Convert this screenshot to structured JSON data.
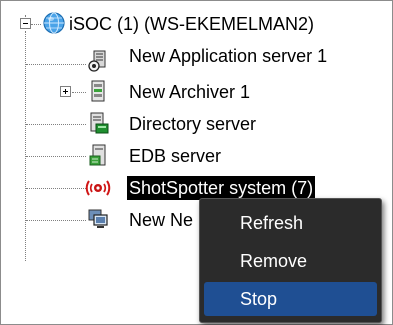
{
  "tree": {
    "root": {
      "label": "iSOC (1) (WS-EKEMELMAN2)",
      "expanded": true
    },
    "items": [
      {
        "label": "New Application server 1",
        "icon": "application-server-icon",
        "expander": false
      },
      {
        "label": "New Archiver 1",
        "icon": "archiver-icon",
        "expander": true,
        "expanded": false
      },
      {
        "label": "Directory server",
        "icon": "directory-server-icon",
        "expander": false
      },
      {
        "label": "EDB server",
        "icon": "edb-server-icon",
        "expander": false
      },
      {
        "label": "ShotSpotter system (7)",
        "icon": "shotspotter-icon",
        "expander": false,
        "selected": true
      },
      {
        "label": "New Network",
        "visible_label": "New Ne",
        "icon": "network-computer-icon",
        "expander": false
      }
    ]
  },
  "context_menu": {
    "items": [
      {
        "label": "Refresh"
      },
      {
        "label": "Remove"
      },
      {
        "label": "Stop",
        "highlighted": true
      }
    ]
  },
  "colors": {
    "selection": "#000000",
    "menu_background": "#2b2b2b",
    "menu_highlight": "#1f4f93"
  }
}
